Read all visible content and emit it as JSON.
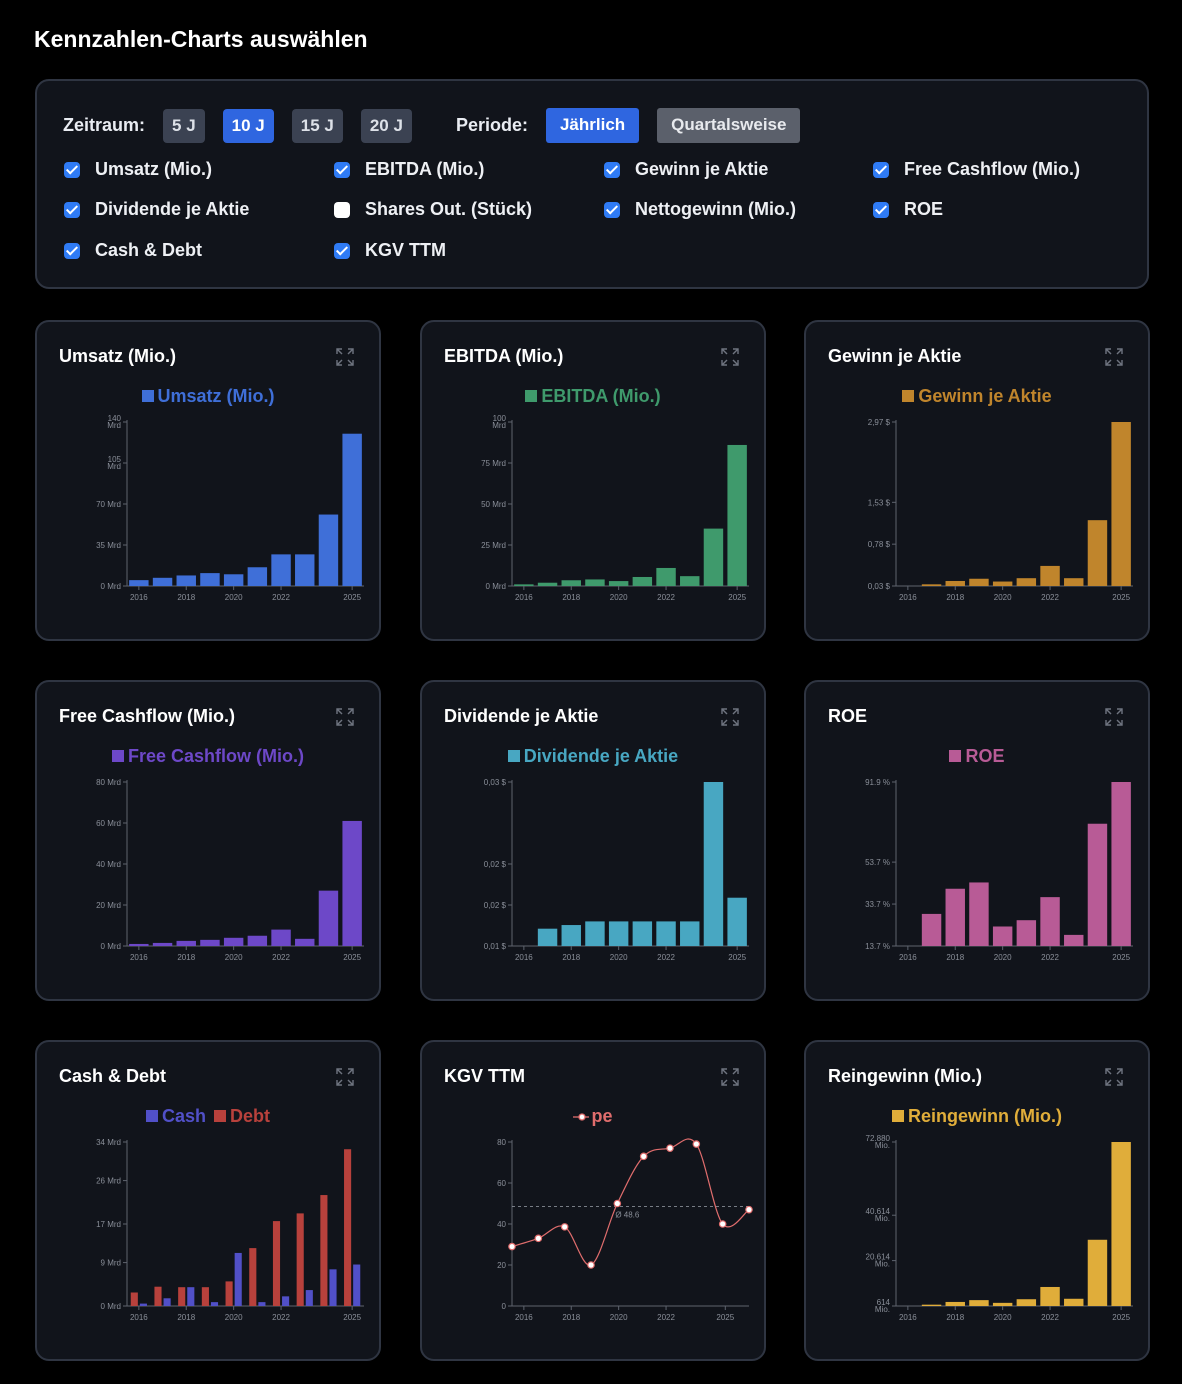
{
  "page": {
    "title": "Kennzahlen-Charts auswählen"
  },
  "controls": {
    "zeitraum_label": "Zeitraum:",
    "ranges": [
      {
        "label": "5 J",
        "active": false
      },
      {
        "label": "10 J",
        "active": true
      },
      {
        "label": "15 J",
        "active": false
      },
      {
        "label": "20 J",
        "active": false
      }
    ],
    "periode_label": "Periode:",
    "periods": [
      {
        "label": "Jährlich",
        "active": true
      },
      {
        "label": "Quartalsweise",
        "active": false
      }
    ],
    "checkboxes": [
      {
        "label": "Umsatz (Mio.)",
        "checked": true
      },
      {
        "label": "EBITDA (Mio.)",
        "checked": true
      },
      {
        "label": "Gewinn je Aktie",
        "checked": true
      },
      {
        "label": "Free Cashflow (Mio.)",
        "checked": true
      },
      {
        "label": "Dividende je Aktie",
        "checked": true
      },
      {
        "label": "Shares Out. (Stück)",
        "checked": false
      },
      {
        "label": "Nettogewinn (Mio.)",
        "checked": true
      },
      {
        "label": "ROE",
        "checked": true
      },
      {
        "label": "Cash & Debt",
        "checked": true
      },
      {
        "label": "KGV TTM",
        "checked": true
      }
    ]
  },
  "chart_data": [
    {
      "title": "Umsatz (Mio.)",
      "type": "bar",
      "color": "#3f6fd8",
      "series": [
        {
          "name": "Umsatz (Mio.)",
          "color": "#3f6fd8",
          "values": [
            5,
            7,
            9,
            11,
            10,
            16,
            27,
            27,
            61,
            130
          ]
        }
      ],
      "ylim": [
        0,
        140
      ],
      "yticks": [
        {
          "v": 0,
          "l": [
            "0 Mrd"
          ]
        },
        {
          "v": 35,
          "l": [
            "35 Mrd"
          ]
        },
        {
          "v": 70,
          "l": [
            "70 Mrd"
          ]
        },
        {
          "v": 105,
          "l": [
            "105",
            "Mrd"
          ]
        },
        {
          "v": 140,
          "l": [
            "140",
            "Mrd"
          ]
        }
      ],
      "xticks": [
        {
          "i": 0,
          "l": "2016"
        },
        {
          "i": 2,
          "l": "2018"
        },
        {
          "i": 4,
          "l": "2020"
        },
        {
          "i": 6,
          "l": "2022"
        },
        {
          "i": 9,
          "l": "2025"
        }
      ]
    },
    {
      "title": "EBITDA (Mio.)",
      "type": "bar",
      "color": "#3f9a6c",
      "series": [
        {
          "name": "EBITDA (Mio.)",
          "color": "#3f9a6c",
          "values": [
            1,
            2,
            3.5,
            4,
            3,
            5.5,
            11,
            6,
            35,
            86
          ]
        }
      ],
      "ylim": [
        0,
        100
      ],
      "yticks": [
        {
          "v": 0,
          "l": [
            "0 Mrd"
          ]
        },
        {
          "v": 25,
          "l": [
            "25 Mrd"
          ]
        },
        {
          "v": 50,
          "l": [
            "50 Mrd"
          ]
        },
        {
          "v": 75,
          "l": [
            "75 Mrd"
          ]
        },
        {
          "v": 100,
          "l": [
            "100",
            "Mrd"
          ]
        }
      ],
      "xticks": [
        {
          "i": 0,
          "l": "2016"
        },
        {
          "i": 2,
          "l": "2018"
        },
        {
          "i": 4,
          "l": "2020"
        },
        {
          "i": 6,
          "l": "2022"
        },
        {
          "i": 9,
          "l": "2025"
        }
      ]
    },
    {
      "title": "Gewinn je Aktie",
      "type": "bar",
      "color": "#c0852c",
      "series": [
        {
          "name": "Gewinn je Aktie",
          "color": "#c0852c",
          "values": [
            0.03,
            0.06,
            0.12,
            0.16,
            0.11,
            0.17,
            0.39,
            0.17,
            1.21,
            2.97
          ]
        }
      ],
      "ylim": [
        0.03,
        2.97
      ],
      "yticks": [
        {
          "v": 0.03,
          "l": [
            "0,03 $"
          ]
        },
        {
          "v": 0.78,
          "l": [
            "0,78 $"
          ]
        },
        {
          "v": 1.53,
          "l": [
            "1,53 $"
          ]
        },
        {
          "v": 2.97,
          "l": [
            "2,97 $"
          ]
        }
      ],
      "xticks": [
        {
          "i": 0,
          "l": "2016"
        },
        {
          "i": 2,
          "l": "2018"
        },
        {
          "i": 4,
          "l": "2020"
        },
        {
          "i": 6,
          "l": "2022"
        },
        {
          "i": 9,
          "l": "2025"
        }
      ]
    },
    {
      "title": "Free Cashflow (Mio.)",
      "type": "bar",
      "color": "#6d48c8",
      "series": [
        {
          "name": "Free Cashflow (Mio.)",
          "color": "#6d48c8",
          "values": [
            1,
            1.5,
            2.5,
            3,
            4,
            5,
            8,
            3.5,
            27,
            61
          ]
        }
      ],
      "ylim": [
        0,
        80
      ],
      "yticks": [
        {
          "v": 0,
          "l": [
            "0 Mrd"
          ]
        },
        {
          "v": 20,
          "l": [
            "20 Mrd"
          ]
        },
        {
          "v": 40,
          "l": [
            "40 Mrd"
          ]
        },
        {
          "v": 60,
          "l": [
            "60 Mrd"
          ]
        },
        {
          "v": 80,
          "l": [
            "80 Mrd"
          ]
        }
      ],
      "xticks": [
        {
          "i": 0,
          "l": "2016"
        },
        {
          "i": 2,
          "l": "2018"
        },
        {
          "i": 4,
          "l": "2020"
        },
        {
          "i": 6,
          "l": "2022"
        },
        {
          "i": 9,
          "l": "2025"
        }
      ]
    },
    {
      "title": "Dividende je Aktie",
      "type": "bar",
      "color": "#48a7c2",
      "series": [
        {
          "name": "Dividende je Aktie",
          "color": "#48a7c2",
          "values": [
            0.01,
            0.0139,
            0.0143,
            0.0147,
            0.0147,
            0.0147,
            0.0147,
            0.0147,
            0.03,
            0.0173
          ]
        }
      ],
      "ylim": [
        0.012,
        0.03
      ],
      "yticks": [
        {
          "v": 0.012,
          "l": [
            "0,01 $"
          ]
        },
        {
          "v": 0.0165,
          "l": [
            "0,02 $"
          ]
        },
        {
          "v": 0.021,
          "l": [
            "0,02 $"
          ]
        },
        {
          "v": 0.03,
          "l": [
            "0,03 $"
          ]
        }
      ],
      "xticks": [
        {
          "i": 0,
          "l": "2016"
        },
        {
          "i": 2,
          "l": "2018"
        },
        {
          "i": 4,
          "l": "2020"
        },
        {
          "i": 6,
          "l": "2022"
        },
        {
          "i": 9,
          "l": "2025"
        }
      ]
    },
    {
      "title": "ROE",
      "type": "bar",
      "color": "#b85b96",
      "series": [
        {
          "name": "ROE",
          "color": "#b85b96",
          "values": [
            13.7,
            29,
            41,
            44,
            23,
            26,
            37,
            19,
            72,
            91.9
          ]
        }
      ],
      "ylim": [
        13.7,
        91.9
      ],
      "yticks": [
        {
          "v": 13.7,
          "l": [
            "13.7 %"
          ]
        },
        {
          "v": 33.7,
          "l": [
            "33.7 %"
          ]
        },
        {
          "v": 53.7,
          "l": [
            "53.7 %"
          ]
        },
        {
          "v": 91.9,
          "l": [
            "91.9 %"
          ]
        }
      ],
      "xticks": [
        {
          "i": 0,
          "l": "2016"
        },
        {
          "i": 2,
          "l": "2018"
        },
        {
          "i": 4,
          "l": "2020"
        },
        {
          "i": 6,
          "l": "2022"
        },
        {
          "i": 9,
          "l": "2025"
        }
      ]
    },
    {
      "title": "Cash & Debt",
      "type": "grouped_bar",
      "series": [
        {
          "name": "Cash",
          "color": "#5150c8",
          "values": [
            0.5,
            1.6,
            3.9,
            0.8,
            11,
            0.8,
            2,
            3.3,
            7.6,
            8.6
          ]
        },
        {
          "name": "Debt",
          "color": "#b8413c",
          "values": [
            2.8,
            4,
            3.9,
            3.9,
            5.1,
            12,
            17.6,
            19.2,
            23,
            32.5
          ]
        }
      ],
      "ylim": [
        0,
        34
      ],
      "yticks": [
        {
          "v": 0,
          "l": [
            "0 Mrd"
          ]
        },
        {
          "v": 9,
          "l": [
            "9 Mrd"
          ]
        },
        {
          "v": 17,
          "l": [
            "17 Mrd"
          ]
        },
        {
          "v": 26,
          "l": [
            "26 Mrd"
          ]
        },
        {
          "v": 34,
          "l": [
            "34 Mrd"
          ]
        }
      ],
      "xticks": [
        {
          "i": 0,
          "l": "2016"
        },
        {
          "i": 2,
          "l": "2018"
        },
        {
          "i": 4,
          "l": "2020"
        },
        {
          "i": 6,
          "l": "2022"
        },
        {
          "i": 9,
          "l": "2025"
        }
      ]
    },
    {
      "title": "KGV TTM",
      "type": "line",
      "series": [
        {
          "name": "pe",
          "color": "#e06d6d",
          "values": [
            29,
            33,
            38.6,
            20,
            50,
            73,
            77,
            79,
            40,
            47
          ]
        }
      ],
      "ylim": [
        0,
        80
      ],
      "yticks": [
        {
          "v": 0,
          "l": [
            "0"
          ]
        },
        {
          "v": 20,
          "l": [
            "20"
          ]
        },
        {
          "v": 40,
          "l": [
            "40"
          ]
        },
        {
          "v": 60,
          "l": [
            "60"
          ]
        },
        {
          "v": 80,
          "l": [
            "80"
          ]
        }
      ],
      "mean": 48.6,
      "mean_label": "Ø 48.6",
      "xticks": [
        {
          "i": 0,
          "l": "2016"
        },
        {
          "i": 2,
          "l": "2018"
        },
        {
          "i": 4,
          "l": "2020"
        },
        {
          "i": 6,
          "l": "2022"
        },
        {
          "i": 8.5,
          "l": "2025"
        }
      ]
    },
    {
      "title": "Reingewinn (Mio.)",
      "type": "bar",
      "color": "#e0ad3a",
      "series": [
        {
          "name": "Reingewinn (Mio.)",
          "color": "#e0ad3a",
          "values": [
            614,
            1200,
            2400,
            3200,
            2000,
            3600,
            9000,
            3800,
            29800,
            72880
          ]
        }
      ],
      "ylim": [
        614,
        72880
      ],
      "yticks": [
        {
          "v": 614,
          "l": [
            "614",
            "Mio."
          ]
        },
        {
          "v": 20614,
          "l": [
            "20.614",
            "Mio."
          ]
        },
        {
          "v": 40614,
          "l": [
            "40.614",
            "Mio."
          ]
        },
        {
          "v": 72880,
          "l": [
            "72.880",
            "Mio."
          ]
        }
      ],
      "xticks": [
        {
          "i": 0,
          "l": "2016"
        },
        {
          "i": 2,
          "l": "2018"
        },
        {
          "i": 4,
          "l": "2020"
        },
        {
          "i": 6,
          "l": "2022"
        },
        {
          "i": 9,
          "l": "2025"
        }
      ]
    }
  ]
}
